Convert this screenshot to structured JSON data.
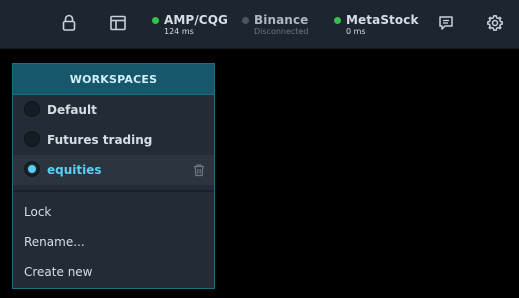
{
  "topbar": {
    "icons": [
      "lock-icon",
      "layout-icon",
      "chat-icon",
      "gear-icon"
    ],
    "connections": [
      {
        "name": "AMP/CQG",
        "status": "124 ms",
        "connected": true
      },
      {
        "name": "Binance",
        "status": "Disconnected",
        "connected": false
      },
      {
        "name": "MetaStock",
        "status": "0 ms",
        "connected": true
      }
    ]
  },
  "colors": {
    "connected": "#35c24a",
    "disconnected": "#4b5560",
    "accent": "#5ad0f2",
    "header": "#16576b"
  },
  "workspaces": {
    "title": "WORKSPACES",
    "items": [
      {
        "label": "Default",
        "selected": false
      },
      {
        "label": "Futures trading",
        "selected": false
      },
      {
        "label": "equities",
        "selected": true
      }
    ],
    "actions": [
      "Lock",
      "Rename...",
      "Create new"
    ]
  }
}
